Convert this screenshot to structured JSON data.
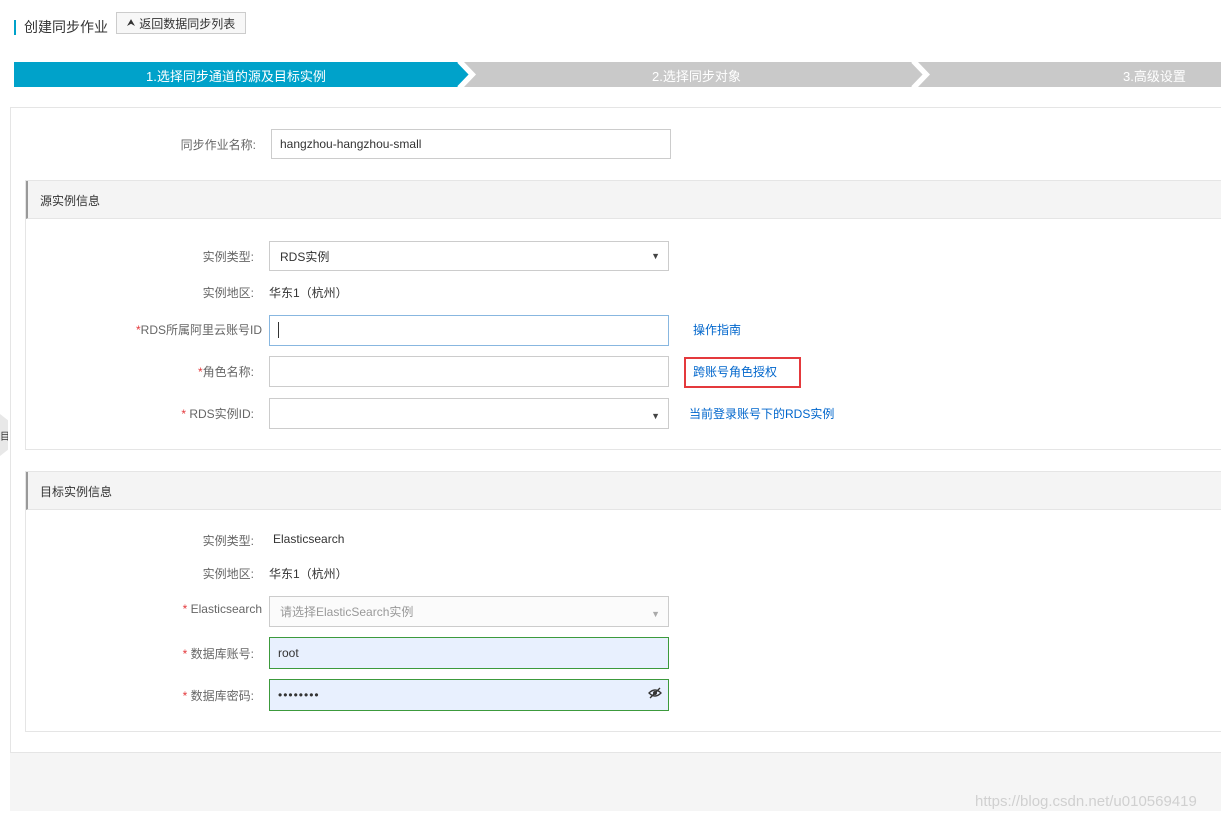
{
  "header": {
    "page_title": "创建同步作业",
    "back_button_label": "返回数据同步列表"
  },
  "steps": [
    {
      "label": "1.选择同步通道的源及目标实例",
      "active": true
    },
    {
      "label": "2.选择同步对象",
      "active": false
    },
    {
      "label": "3.高级设置",
      "active": false
    }
  ],
  "job": {
    "name_label": "同步作业名称:",
    "name_value": "hangzhou-hangzhou-small"
  },
  "source": {
    "section_title": "源实例信息",
    "instance_type_label": "实例类型:",
    "instance_type_value": "RDS实例",
    "region_label": "实例地区:",
    "region_value": "华东1（杭州）",
    "account_id_label": "RDS所属阿里云账号ID",
    "account_id_value": "",
    "guide_link": "操作指南",
    "role_label": "角色名称:",
    "role_value": "",
    "cross_account_link": "跨账号角色授权",
    "rds_id_label": "RDS实例ID:",
    "rds_id_value": "",
    "current_rds_link": "当前登录账号下的RDS实例"
  },
  "target": {
    "section_title": "目标实例信息",
    "instance_type_label": "实例类型:",
    "instance_type_value": "Elasticsearch",
    "region_label": "实例地区:",
    "region_value": "华东1（杭州）",
    "es_label": "Elasticsearch",
    "es_placeholder": "请选择ElasticSearch实例",
    "db_account_label": "数据库账号:",
    "db_account_value": "root",
    "db_password_label": "数据库密码:",
    "db_password_value": "••••••••"
  },
  "required_mark": "*",
  "side_tab_glyph": "目",
  "watermark": "https://blog.csdn.net/u010569419",
  "colors": {
    "active_step": "#00a2ca",
    "inactive_step": "#c9c9c9",
    "required": "#e4393c",
    "link": "#0066cc"
  }
}
